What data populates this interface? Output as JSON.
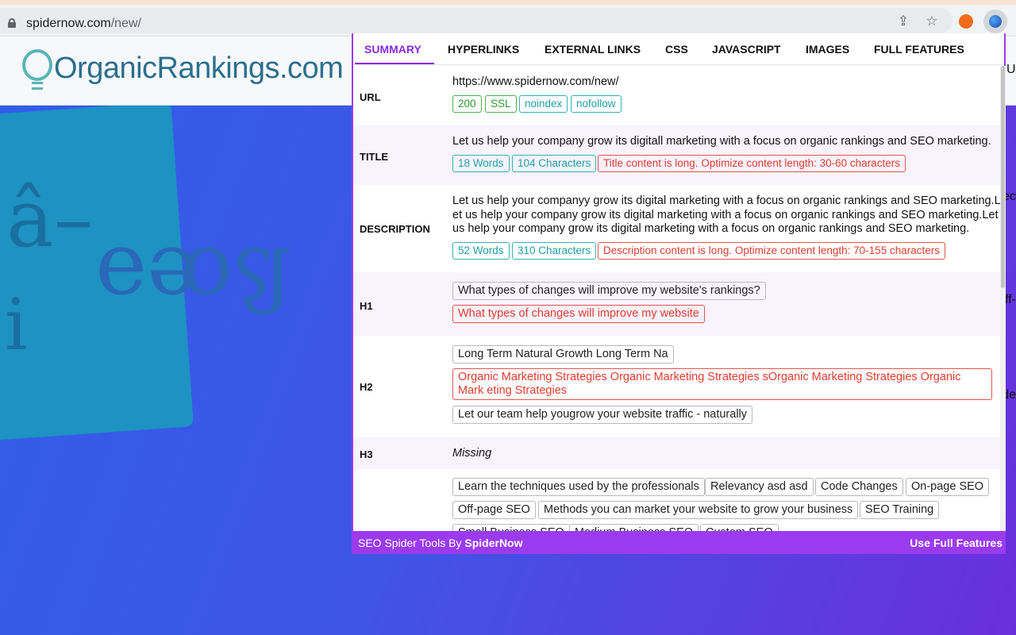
{
  "browser": {
    "url_host": "spidernow.com",
    "url_path": "/new/",
    "share_icon": "share-icon",
    "bookmark_icon": "star-icon"
  },
  "site": {
    "logo_text": "OrganicRankings.com",
    "right_fragments": [
      "U",
      "ec",
      "ff-",
      "de"
    ]
  },
  "popup": {
    "tabs": [
      "SUMMARY",
      "HYPERLINKS",
      "EXTERNAL LINKS",
      "CSS",
      "JAVASCRIPT",
      "IMAGES",
      "FULL FEATURES"
    ],
    "url_row": {
      "label": "URL",
      "value": "https://www.spidernow.com/new/",
      "tags": [
        "200",
        "SSL",
        "noindex",
        "nofollow"
      ]
    },
    "title_row": {
      "label": "TITLE",
      "value": "Let us help your company grow its digitall marketing with a focus on organic rankings and SEO marketing.",
      "words": "18 Words",
      "chars": "104 Characters",
      "warning": "Title content is long. Optimize content length: 30-60 characters"
    },
    "description_row": {
      "label": "DESCRIPTION",
      "lines": [
        "Let us help your companyy grow its digital marketing with a focus on organic rankings and SEO marketing.L",
        "et us help your company grow its digital marketing with a focus on organic rankings and SEO marketing.Let",
        "us help your company grow its digital marketing with a focus on organic rankings and SEO marketing."
      ],
      "words": "52 Words",
      "chars": "310 Characters",
      "warning": "Description content is long. Optimize content length: 70-155 characters"
    },
    "h1_row": {
      "label": "H1",
      "items": [
        "What types of changes will improve my website's rankings?",
        "What types of changes will improve my website"
      ]
    },
    "h2_row": {
      "label": "H2",
      "items": [
        "Long Term Natural Growth Long Term Na",
        "Organic Marketing Strategies Organic Marketing Strategies sOrganic Marketing Strategies Organic Mark eting Strategies",
        "Let our team help yougrow your website traffic - naturally"
      ]
    },
    "h3_row": {
      "label": "H3",
      "value": "Missing"
    },
    "h4_row": {
      "items": [
        "Learn the techniques used by the professionals",
        "Relevancy asd asd",
        "Code Changes",
        "On-page SEO",
        "Off-page SEO",
        "Methods you can market your website to grow your business",
        "SEO Training",
        "Small Business SEO",
        "Medium Business SEO",
        "Custom SEO"
      ]
    },
    "footer": {
      "prefix": "SEO Spider Tools By ",
      "brand": "SpiderNow",
      "cta": "Use Full Features"
    }
  }
}
